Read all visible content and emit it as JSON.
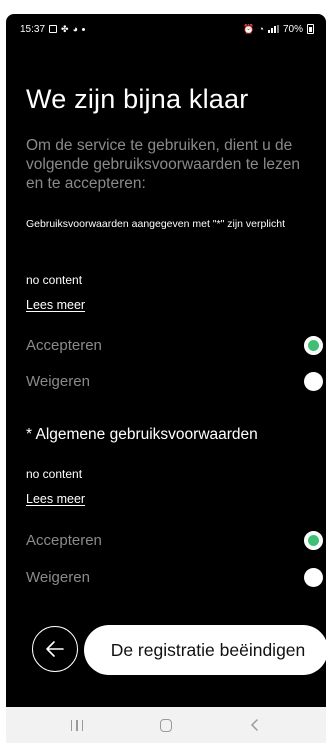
{
  "status_bar": {
    "time": "15:37",
    "battery": "70%"
  },
  "title": "We zijn bijna klaar",
  "intro": "Om de service te gebruiken, dient u de volgende gebruiksvoorwaarden te lezen en te accepteren:",
  "required_note": "Gebruiksvoorwaarden aangegeven met \"*\" zijn verplicht",
  "sections": [
    {
      "heading": "",
      "content": "no content",
      "read_more": "Lees meer",
      "accept_label": "Accepteren",
      "decline_label": "Weigeren",
      "selected": "accept"
    },
    {
      "heading": "* Algemene gebruiksvoorwaarden",
      "content": "no content",
      "read_more": "Lees meer",
      "accept_label": "Accepteren",
      "decline_label": "Weigeren",
      "selected": "accept"
    }
  ],
  "end_button": "De registratie beëindigen",
  "colors": {
    "background": "#000000",
    "accent_selected": "#3fbf75",
    "muted_text": "#8a8a8a"
  },
  "icons": {
    "back": "arrow-left-icon",
    "nav_recents": "recents-icon",
    "nav_home": "home-icon",
    "nav_back": "back-chevron-icon"
  }
}
